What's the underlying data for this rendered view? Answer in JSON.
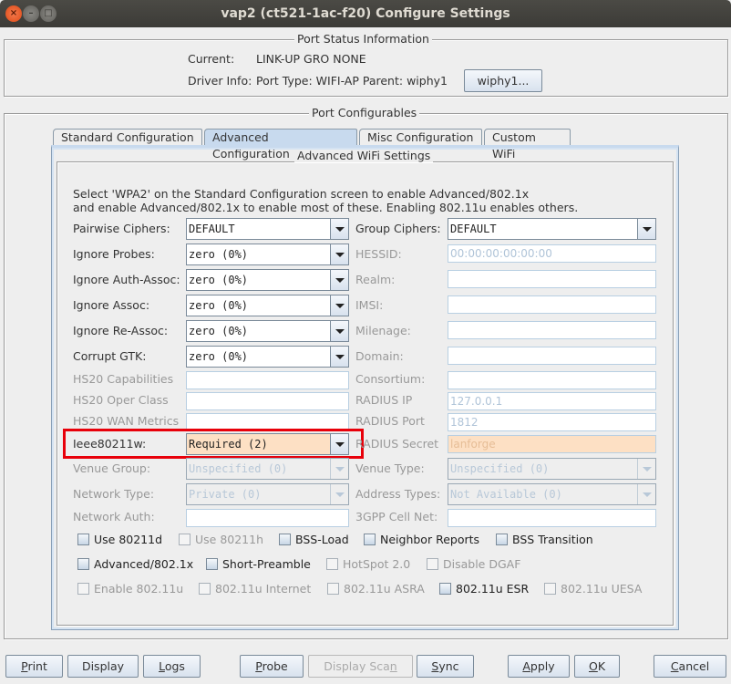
{
  "window": {
    "title": "vap2  (ct521-1ac-f20) Configure Settings",
    "controls": [
      "close",
      "minimize",
      "maximize"
    ]
  },
  "port_status": {
    "title": "Port Status Information",
    "current_label": "Current:",
    "current_value": "LINK-UP GRO  NONE",
    "driver_label": "Driver Info:",
    "driver_value": "Port Type: WIFI-AP   Parent: wiphy1",
    "parent_button": "wiphy1..."
  },
  "port_configurables": {
    "title": "Port Configurables",
    "tabs": [
      {
        "label": "Standard Configuration",
        "active": false
      },
      {
        "label": "Advanced Configuration",
        "active": true
      },
      {
        "label": "Misc Configuration",
        "active": false
      },
      {
        "label": "Custom WiFi",
        "active": false
      }
    ]
  },
  "advanced": {
    "title": "Advanced WiFi Settings",
    "info_line1": "Select 'WPA2' on the Standard Configuration screen to enable Advanced/802.1x",
    "info_line2": "and enable Advanced/802.1x to enable most of these. Enabling 802.11u enables others.",
    "left": {
      "pairwise_ciphers": {
        "label": "Pairwise Ciphers:",
        "value": "DEFAULT"
      },
      "ignore_probes": {
        "label": "Ignore Probes:",
        "value": "zero (0%)"
      },
      "ignore_auth_assoc": {
        "label": "Ignore Auth-Assoc:",
        "value": "zero (0%)"
      },
      "ignore_assoc": {
        "label": "Ignore Assoc:",
        "value": "zero (0%)"
      },
      "ignore_re_assoc": {
        "label": "Ignore Re-Assoc:",
        "value": "zero (0%)"
      },
      "corrupt_gtk": {
        "label": "Corrupt GTK:",
        "value": "zero (0%)"
      },
      "hs20_capabilities": {
        "label": "HS20 Capabilities",
        "value": ""
      },
      "hs20_oper_class": {
        "label": "HS20 Oper Class",
        "value": ""
      },
      "hs20_wan_metrics": {
        "label": "HS20 WAN Metrics",
        "value": ""
      },
      "ieee80211w": {
        "label": "Ieee80211w:",
        "value": "Required (2)"
      },
      "venue_group": {
        "label": "Venue Group:",
        "value": "Unspecified (0)"
      },
      "network_type": {
        "label": "Network Type:",
        "value": "Private (0)"
      },
      "network_auth": {
        "label": "Network Auth:",
        "value": ""
      }
    },
    "right": {
      "group_ciphers": {
        "label": "Group Ciphers:",
        "value": "DEFAULT"
      },
      "hessid": {
        "label": "HESSID:",
        "value": "00:00:00:00:00:00"
      },
      "realm": {
        "label": "Realm:",
        "value": ""
      },
      "imsi": {
        "label": "IMSI:",
        "value": ""
      },
      "milenage": {
        "label": "Milenage:",
        "value": ""
      },
      "domain": {
        "label": "Domain:",
        "value": ""
      },
      "consortium": {
        "label": "Consortium:",
        "value": ""
      },
      "radius_ip": {
        "label": "RADIUS IP",
        "value": "127.0.0.1"
      },
      "radius_port": {
        "label": "RADIUS Port",
        "value": "1812"
      },
      "radius_secret": {
        "label": "RADIUS Secret",
        "value": "lanforge"
      },
      "venue_type": {
        "label": "Venue Type:",
        "value": "Unspecified (0)"
      },
      "address_types": {
        "label": "Address Types:",
        "value": "Not Available (0)"
      },
      "cell_net_3gpp": {
        "label": "3GPP Cell Net:",
        "value": ""
      }
    },
    "checkboxes": [
      {
        "label": "Use 80211d",
        "checked": false,
        "enabled": true
      },
      {
        "label": "Use 80211h",
        "checked": false,
        "enabled": false
      },
      {
        "label": "BSS-Load",
        "checked": false,
        "enabled": true
      },
      {
        "label": "Neighbor Reports",
        "checked": false,
        "enabled": true
      },
      {
        "label": "BSS Transition",
        "checked": false,
        "enabled": true
      },
      {
        "label": "Advanced/802.1x",
        "checked": false,
        "enabled": true
      },
      {
        "label": "Short-Preamble",
        "checked": false,
        "enabled": true
      },
      {
        "label": "HotSpot 2.0",
        "checked": false,
        "enabled": false
      },
      {
        "label": "Disable DGAF",
        "checked": false,
        "enabled": false
      },
      {
        "label": "Enable 802.11u",
        "checked": false,
        "enabled": false
      },
      {
        "label": "802.11u Internet",
        "checked": false,
        "enabled": false
      },
      {
        "label": "802.11u ASRA",
        "checked": false,
        "enabled": false
      },
      {
        "label": "802.11u ESR",
        "checked": false,
        "enabled": true
      },
      {
        "label": "802.11u UESA",
        "checked": false,
        "enabled": false
      }
    ]
  },
  "footer_buttons": {
    "print": {
      "pre": "",
      "u": "P",
      "post": "rint"
    },
    "display": {
      "label": "Display"
    },
    "logs": {
      "pre": "",
      "u": "L",
      "post": "ogs"
    },
    "probe": {
      "pre": "",
      "u": "P",
      "post": "robe"
    },
    "display_scan": {
      "pre": "Display Sca",
      "u": "n",
      "post": "",
      "enabled": false
    },
    "sync": {
      "pre": "",
      "u": "S",
      "post": "ync"
    },
    "apply": {
      "pre": "",
      "u": "A",
      "post": "pply"
    },
    "ok": {
      "pre": "",
      "u": "O",
      "post": "K"
    },
    "cancel": {
      "pre": "",
      "u": "C",
      "post": "ancel"
    }
  },
  "colors": {
    "highlight_border": "#e8000a",
    "modified_field": "#fde0c4",
    "active_tab": "#c8daee"
  }
}
